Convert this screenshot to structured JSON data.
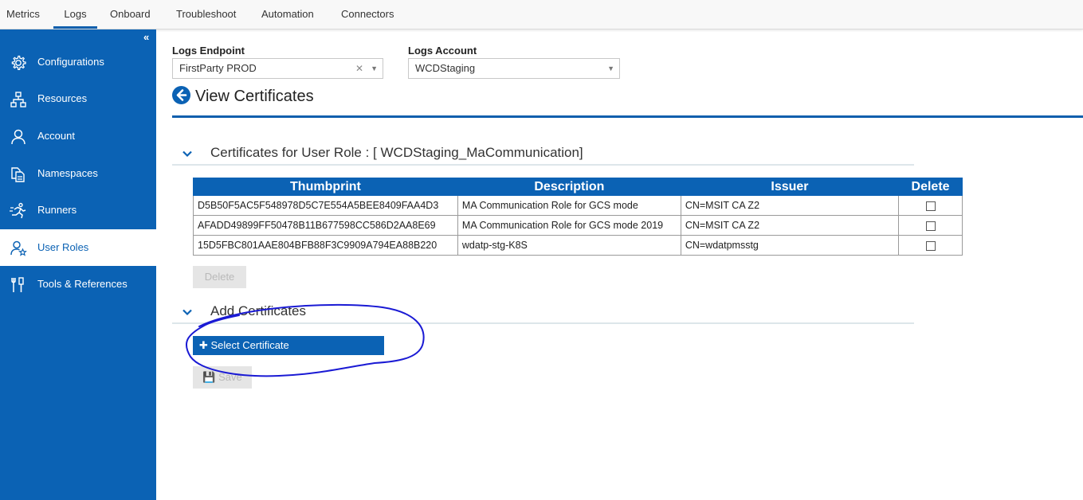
{
  "topnav": {
    "tabs": [
      {
        "label": "Metrics"
      },
      {
        "label": "Logs"
      },
      {
        "label": "Onboard"
      },
      {
        "label": "Troubleshoot"
      },
      {
        "label": "Automation"
      },
      {
        "label": "Connectors"
      }
    ],
    "active": "Logs"
  },
  "sidebar": {
    "collapse_glyph": "«",
    "items": [
      {
        "label": "Configurations",
        "icon": "gear-icon"
      },
      {
        "label": "Resources",
        "icon": "sitemap-icon"
      },
      {
        "label": "Account",
        "icon": "user-icon"
      },
      {
        "label": "Namespaces",
        "icon": "documents-icon"
      },
      {
        "label": "Runners",
        "icon": "runner-icon"
      },
      {
        "label": "User Roles",
        "icon": "user-roles-icon"
      },
      {
        "label": "Tools & References",
        "icon": "tools-icon"
      }
    ],
    "active": "User Roles"
  },
  "filters": {
    "endpoint": {
      "label": "Logs Endpoint",
      "value": "FirstParty PROD"
    },
    "account": {
      "label": "Logs Account",
      "value": "WCDStaging"
    }
  },
  "page": {
    "title": "View Certificates"
  },
  "certificates_section": {
    "heading": "Certificates for User Role : [ WCDStaging_MaCommunication]",
    "columns": [
      "Thumbprint",
      "Description",
      "Issuer",
      "Delete"
    ],
    "rows": [
      {
        "thumbprint": "D5B50F5AC5F548978D5C7E554A5BEE8409FAA4D3",
        "description": "MA Communication Role for GCS mode",
        "issuer": "CN=MSIT CA Z2",
        "delete_checked": false
      },
      {
        "thumbprint": "AFADD49899FF50478B11B677598CC586D2AA8E69",
        "description": "MA Communication Role for GCS mode 2019",
        "issuer": "CN=MSIT CA Z2",
        "delete_checked": false
      },
      {
        "thumbprint": "15D5FBC801AAE804BFB88F3C9909A794EA88B220",
        "description": "wdatp-stg-K8S",
        "issuer": "CN=wdatpmsstg",
        "delete_checked": false
      }
    ],
    "delete_button": "Delete"
  },
  "add_section": {
    "heading": "Add Certificates",
    "select_button": "Select Certificate",
    "save_button": "Save"
  },
  "colors": {
    "brand_blue": "#0b62b4",
    "annotation_ink": "#1a1ad4"
  }
}
